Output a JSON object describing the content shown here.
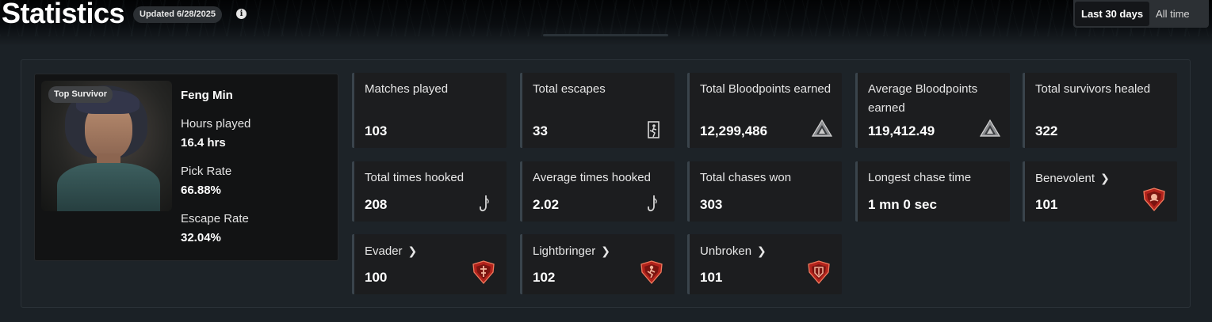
{
  "header": {
    "title": "Statistics",
    "updated": "Updated 6/28/2025",
    "range_options": [
      "Last 30 days",
      "All time"
    ],
    "selected_range": "Last 30 days"
  },
  "character": {
    "badge": "Top Survivor",
    "name": "Feng Min",
    "hours_label": "Hours played",
    "hours_value": "16.4 hrs",
    "pick_label": "Pick Rate",
    "pick_value": "66.88%",
    "escape_label": "Escape Rate",
    "escape_value": "32.04%"
  },
  "stats": [
    {
      "label": "Matches played",
      "value": "103",
      "icon": "none"
    },
    {
      "label": "Total escapes",
      "value": "33",
      "icon": "exit-door-icon"
    },
    {
      "label": "Total Bloodpoints earned",
      "value": "12,299,486",
      "icon": "bloodpoints-icon"
    },
    {
      "label": "Average Bloodpoints earned",
      "value": "119,412.49",
      "icon": "bloodpoints-icon"
    },
    {
      "label": "Total survivors healed",
      "value": "322",
      "icon": "none"
    },
    {
      "label": "Total times hooked",
      "value": "208",
      "icon": "hook-icon"
    },
    {
      "label": "Average times hooked",
      "value": "2.02",
      "icon": "hook-icon"
    },
    {
      "label": "Total chases won",
      "value": "303",
      "icon": "none"
    },
    {
      "label": "Longest chase time",
      "value": "1 mn 0 sec",
      "icon": "none"
    },
    {
      "label": "Benevolent",
      "value": "101",
      "icon": "emblem-icon",
      "link": true
    },
    {
      "label": "Evader",
      "value": "100",
      "icon": "emblem-icon",
      "link": true
    },
    {
      "label": "Lightbringer",
      "value": "102",
      "icon": "emblem-icon",
      "link": true
    },
    {
      "label": "Unbroken",
      "value": "101",
      "icon": "emblem-icon",
      "link": true
    }
  ],
  "colors": {
    "background": "#1b2126",
    "card": "#1c1d1f",
    "card_accent": "#3a444c",
    "emblem_red": "#b3231c"
  }
}
